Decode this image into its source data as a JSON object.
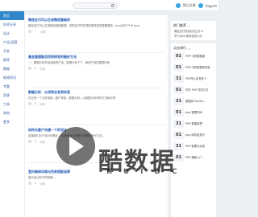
{
  "header": {
    "user_label": "登记文章",
    "user_name": "itagent"
  },
  "nav": {
    "items": [
      "首页",
      "技术分享",
      "设计",
      "产品/运营",
      "开发",
      "推荐",
      "数据",
      "新闻资讯",
      "专题",
      "资源",
      "工具",
      "其他",
      "更多"
    ]
  },
  "posts": [
    {
      "title": "微信支付可以生成微信基础的",
      "excerpt": "微信支付可以生成微信基础数据...发现支付时的调查是请发现重要更新...Java支付 PHP Java",
      "views": "...",
      "author": "小明"
    },
    {
      "title": "基金管理能否找到研发的最好方法",
      "excerpt": "一、数据分析并找到高的产品...数据分析了了...我的产品的数据分析",
      "views": "0",
      "author": "小明"
    },
    {
      "title": "数据分析：从找到业务到实现",
      "excerpt": "在业务一个业务场景...客户体验...数据分析...以数据为参考的方法和实例",
      "views": "0",
      "author": "小明"
    },
    {
      "title": "如何与客户沟通一个的设计",
      "excerpt": "如果我们对于设计的看法...与其他设计内的行内规范进行交流...",
      "views": "0",
      "author": "小明"
    },
    {
      "title": "室内装修风格与色彩搭配选择",
      "excerpt": "室内设计的不同风格...",
      "views": "0",
      "author": "小明"
    }
  ],
  "sidebar": {
    "recommend_title": "热门推荐",
    "recommend_items": [
      "微信支付完成后发生什么",
      "学了JAVA,那我该怎么办"
    ],
    "ranking_title": "点击排行",
    "ranking": [
      {
        "num": "01",
        "text": "PHP 中的数据源"
      },
      {
        "num": "01",
        "text": "PHP 中的数据和变量"
      },
      {
        "num": "31",
        "text": "PHP怎么实现多个..."
      },
      {
        "num": "01",
        "text": "在学 PHP 时的方法"
      },
      {
        "num": "31",
        "text": "数据库 MySQL..."
      },
      {
        "num": "01",
        "text": "php 整理时间"
      },
      {
        "num": "31",
        "text": "PHP 数据处理"
      },
      {
        "num": "01",
        "text": "php 网站相关的"
      },
      {
        "num": "31",
        "text": "PHP 整理与实现"
      },
      {
        "num": "01",
        "text": "PHP 编程入门"
      }
    ]
  },
  "watermark": {
    "title": "酷数据",
    "letters": "KUIDC"
  }
}
